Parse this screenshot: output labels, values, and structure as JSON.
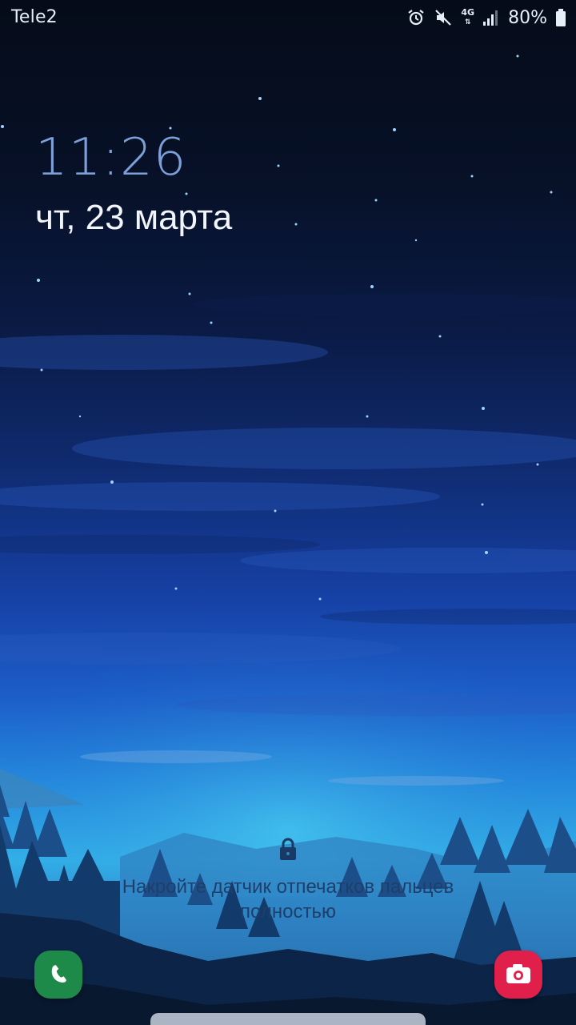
{
  "status_bar": {
    "carrier": "Tele2",
    "network_type": "4G",
    "battery_percent": "80%",
    "icons": [
      "alarm-icon",
      "mute-icon",
      "network-4g-icon",
      "signal-icon",
      "battery-icon"
    ]
  },
  "lock_screen": {
    "time": "11:26",
    "date": "чт, 23 марта",
    "fingerprint_hint_line1": "Накройте датчик отпечатков пальцев",
    "fingerprint_hint_line2": "полностью"
  },
  "shortcuts": {
    "left": "phone-icon",
    "right": "camera-icon"
  },
  "colors": {
    "phone_shortcut": "#1d8a4a",
    "camera_shortcut": "#e0204a",
    "clock_text": "#7da0d8",
    "hint_text": "#1f3f6a"
  }
}
